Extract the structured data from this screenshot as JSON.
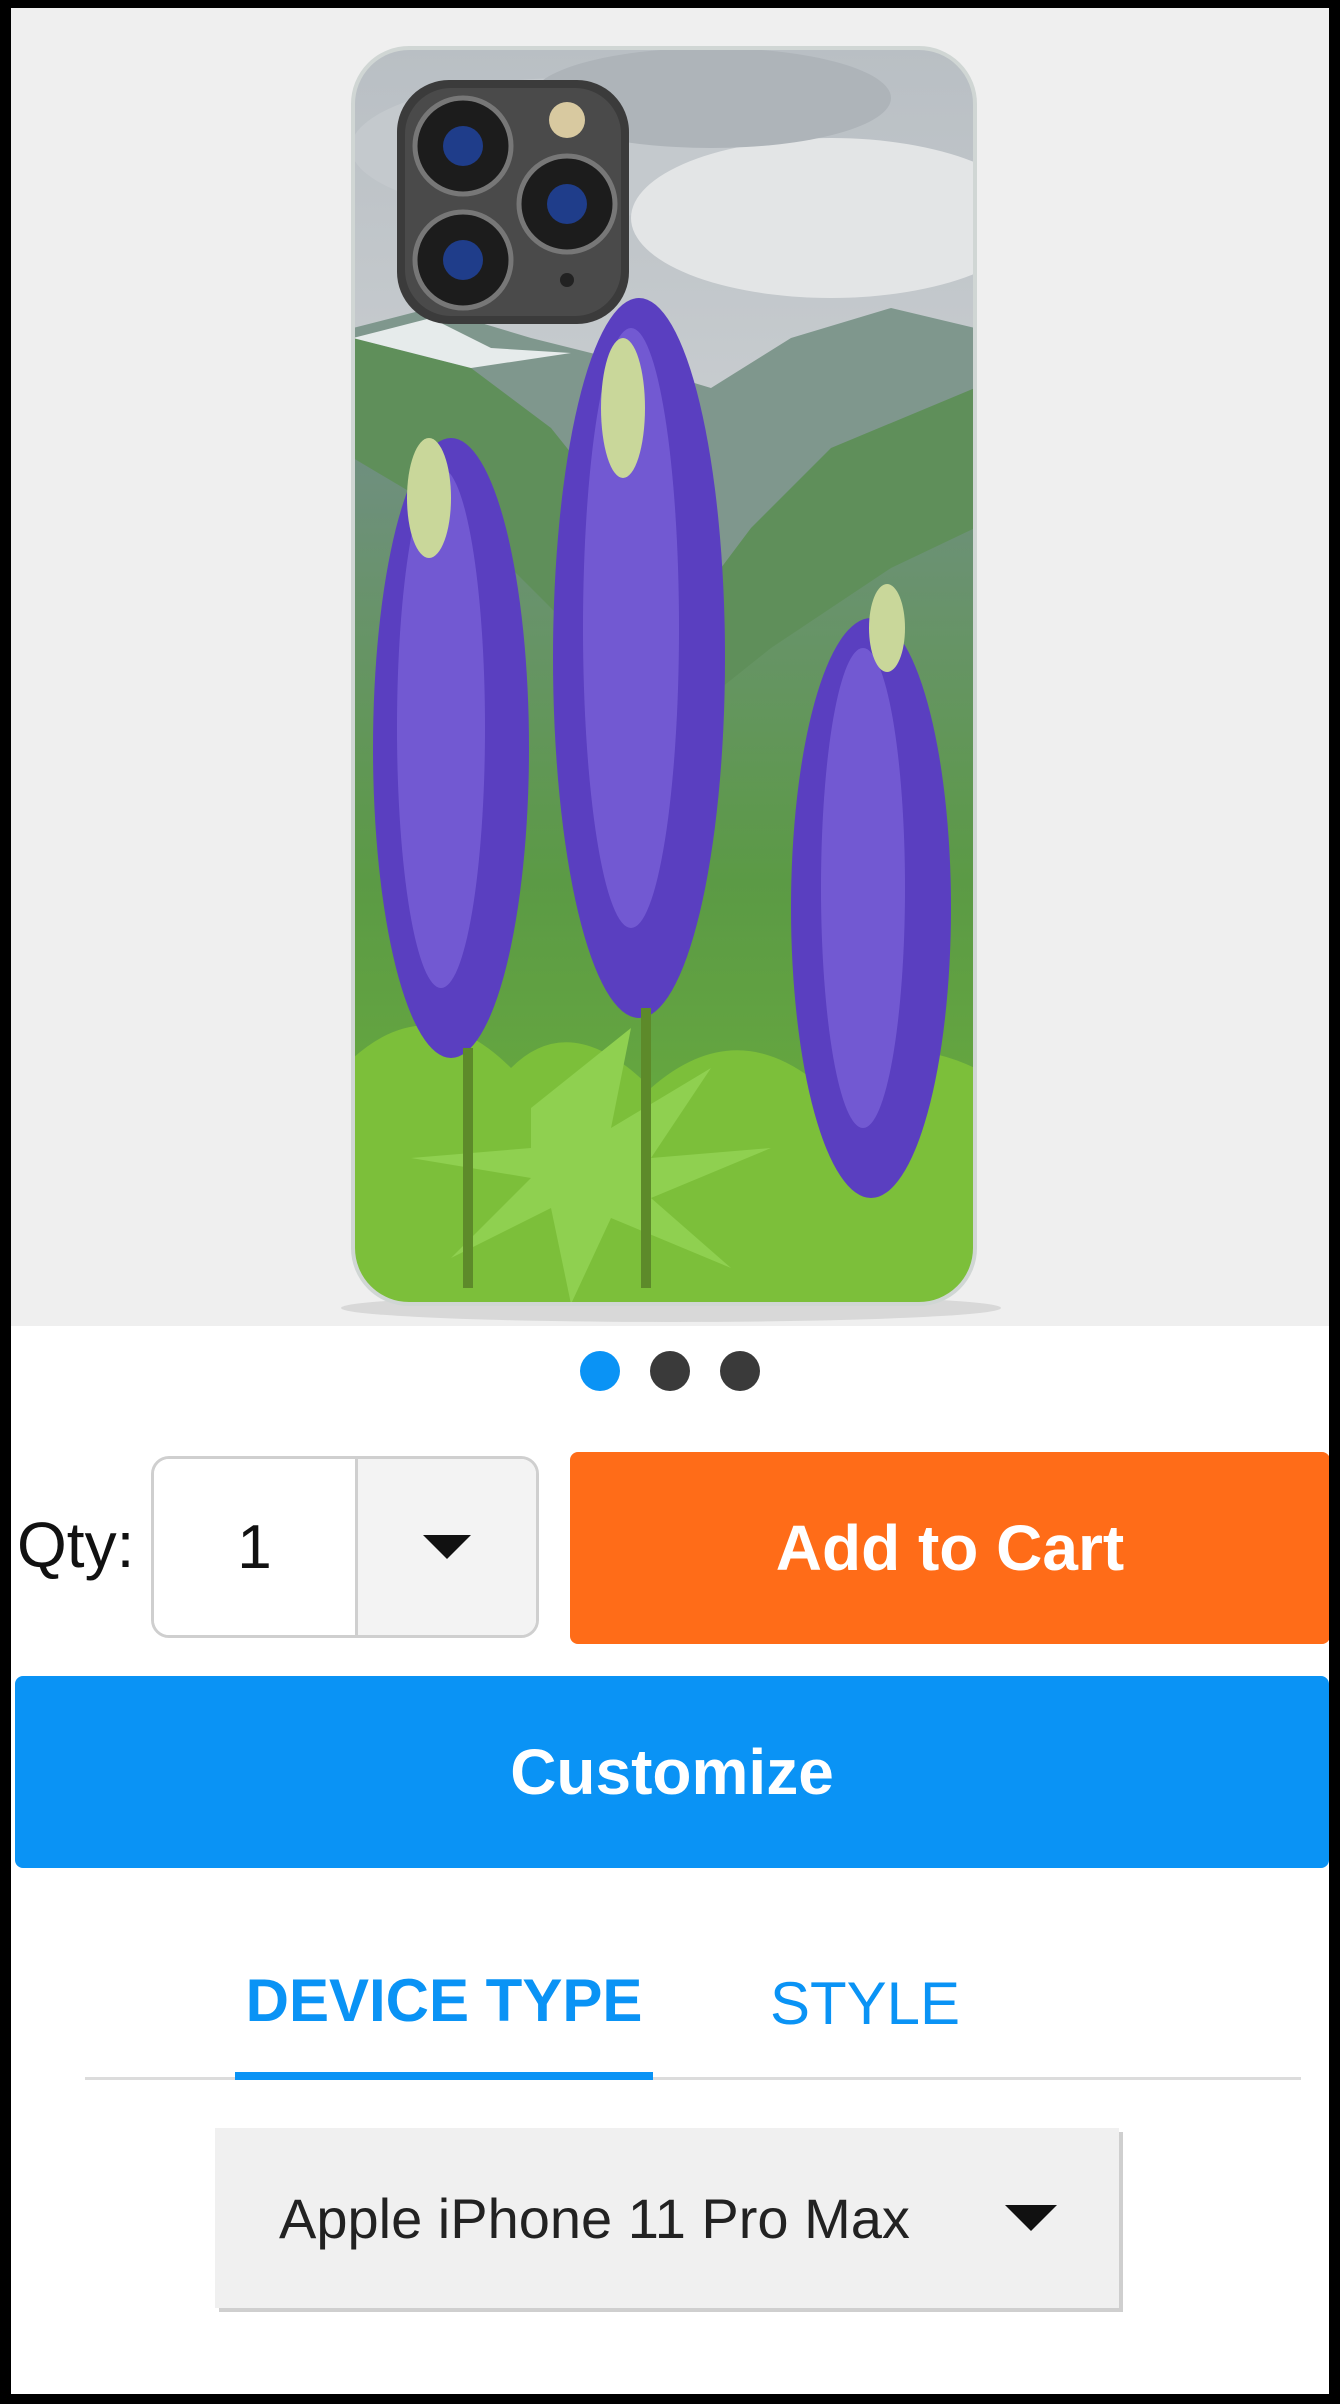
{
  "carousel": {
    "dots": [
      {
        "active": true,
        "color": "#0a93f5"
      },
      {
        "active": false,
        "color": "#3a3a3a"
      },
      {
        "active": false,
        "color": "#3a3a3a"
      }
    ]
  },
  "purchase": {
    "qty_label": "Qty:",
    "qty_value": "1",
    "add_to_cart_label": "Add to Cart",
    "customize_label": "Customize"
  },
  "tabs": [
    {
      "label": "DEVICE TYPE",
      "active": true
    },
    {
      "label": "STYLE",
      "active": false
    }
  ],
  "device_select": {
    "selected": "Apple iPhone 11 Pro Max"
  },
  "colors": {
    "accent_blue": "#0a93f5",
    "cart_orange": "#ff6c18"
  }
}
